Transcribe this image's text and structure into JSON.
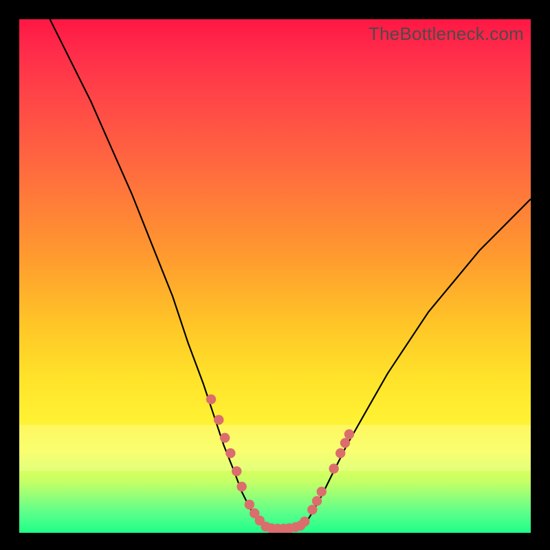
{
  "watermark": "TheBottleneck.com",
  "colors": {
    "top": "#ff1744",
    "mid": "#ffe32a",
    "bottom": "#1eff88",
    "curve": "#000000",
    "dots": "#db6d6d"
  },
  "chart_data": {
    "type": "line",
    "title": "",
    "xlabel": "",
    "ylabel": "",
    "xlim": [
      0,
      100
    ],
    "ylim": [
      0,
      100
    ],
    "grid": false,
    "legend": false,
    "series": [
      {
        "name": "left-branch",
        "x": [
          6,
          10,
          14,
          18,
          22,
          26,
          30,
          33,
          36,
          38,
          40,
          42,
          43.5,
          45,
          46.5,
          48
        ],
        "y": [
          100,
          92,
          84,
          75,
          66,
          56,
          46,
          37,
          29,
          23,
          17,
          12,
          8,
          5,
          2.5,
          0.8
        ]
      },
      {
        "name": "valley-floor",
        "x": [
          48,
          50,
          52,
          54,
          55.5
        ],
        "y": [
          0.8,
          0.5,
          0.5,
          0.7,
          1.0
        ]
      },
      {
        "name": "right-branch",
        "x": [
          55.5,
          57,
          59,
          61,
          64,
          68,
          72,
          76,
          80,
          85,
          90,
          95,
          100
        ],
        "y": [
          1.0,
          3.5,
          7,
          11,
          17,
          24,
          31,
          37,
          43,
          49,
          55,
          60,
          65
        ]
      }
    ],
    "markers": {
      "name": "highlight-dots",
      "points": [
        {
          "x": 37.5,
          "y": 26
        },
        {
          "x": 39.0,
          "y": 22
        },
        {
          "x": 40.2,
          "y": 18.5
        },
        {
          "x": 41.3,
          "y": 15.5
        },
        {
          "x": 42.5,
          "y": 12
        },
        {
          "x": 43.5,
          "y": 9
        },
        {
          "x": 45.0,
          "y": 5.5
        },
        {
          "x": 46.0,
          "y": 3.8
        },
        {
          "x": 47.0,
          "y": 2.4
        },
        {
          "x": 48.2,
          "y": 1.2
        },
        {
          "x": 49.3,
          "y": 0.9
        },
        {
          "x": 50.5,
          "y": 0.8
        },
        {
          "x": 51.7,
          "y": 0.8
        },
        {
          "x": 52.8,
          "y": 0.9
        },
        {
          "x": 54.0,
          "y": 1.1
        },
        {
          "x": 55.0,
          "y": 1.4
        },
        {
          "x": 55.8,
          "y": 2.2
        },
        {
          "x": 57.3,
          "y": 4.5
        },
        {
          "x": 58.2,
          "y": 6.2
        },
        {
          "x": 59.1,
          "y": 8.0
        },
        {
          "x": 61.5,
          "y": 12.5
        },
        {
          "x": 62.8,
          "y": 15.5
        },
        {
          "x": 63.7,
          "y": 17.5
        },
        {
          "x": 64.5,
          "y": 19.2
        }
      ]
    }
  }
}
